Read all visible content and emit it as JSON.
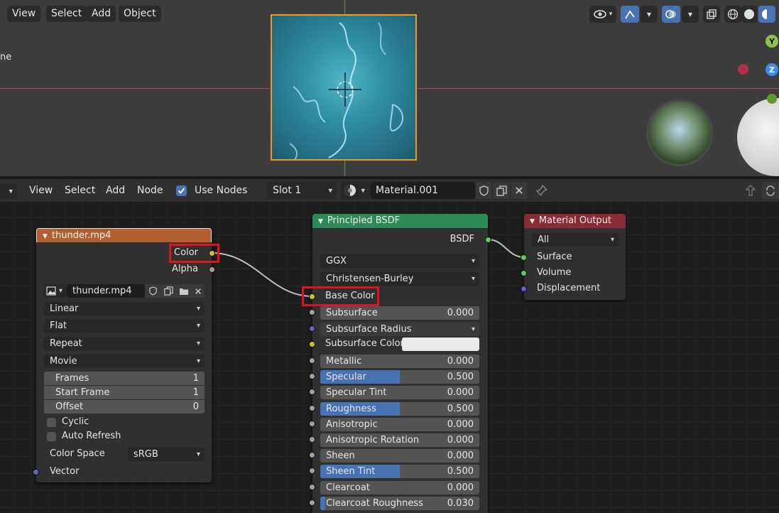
{
  "viewport": {
    "menu": [
      "View",
      "Select",
      "Add",
      "Object"
    ],
    "side_label": "ne",
    "gizmo": {
      "y": "Y",
      "z": "Z"
    }
  },
  "node_editor": {
    "menu": [
      "View",
      "Select",
      "Add",
      "Node"
    ],
    "use_nodes_label": "Use Nodes",
    "slot": "Slot 1",
    "material_name": "Material.001"
  },
  "image_node": {
    "title": "thunder.mp4",
    "outputs": [
      "Color",
      "Alpha"
    ],
    "image_name": "thunder.mp4",
    "interpolation": "Linear",
    "projection": "Flat",
    "extension": "Repeat",
    "source": "Movie",
    "fields": [
      {
        "label": "Frames",
        "value": "1"
      },
      {
        "label": "Start Frame",
        "value": "1"
      },
      {
        "label": "Offset",
        "value": "0"
      }
    ],
    "checkboxes": [
      "Cyclic",
      "Auto Refresh"
    ],
    "color_space_label": "Color Space",
    "color_space": "sRGB",
    "vector_label": "Vector"
  },
  "bsdf_node": {
    "title": "Principled BSDF",
    "output": "BSDF",
    "distribution": "GGX",
    "subsurface_method": "Christensen-Burley",
    "base_color_label": "Base Color",
    "subsurface_label": "Subsurface",
    "subsurface_value": "0.000",
    "subsurface_radius_label": "Subsurface Radius",
    "subsurface_color_label": "Subsurface Color",
    "params": [
      {
        "label": "Metallic",
        "value": "0.000",
        "fill": 0
      },
      {
        "label": "Specular",
        "value": "0.500",
        "fill": 0.5
      },
      {
        "label": "Specular Tint",
        "value": "0.000",
        "fill": 0
      },
      {
        "label": "Roughness",
        "value": "0.500",
        "fill": 0.5
      },
      {
        "label": "Anisotropic",
        "value": "0.000",
        "fill": 0
      },
      {
        "label": "Anisotropic Rotation",
        "value": "0.000",
        "fill": 0
      },
      {
        "label": "Sheen",
        "value": "0.000",
        "fill": 0
      },
      {
        "label": "Sheen Tint",
        "value": "0.500",
        "fill": 0.5
      },
      {
        "label": "Clearcoat",
        "value": "0.000",
        "fill": 0
      },
      {
        "label": "Clearcoat Roughness",
        "value": "0.030",
        "fill": 0.03
      }
    ]
  },
  "output_node": {
    "title": "Material Output",
    "target": "All",
    "inputs": [
      "Surface",
      "Volume",
      "Displacement"
    ]
  },
  "colors": {
    "image_header": "#b25f2f",
    "bsdf_header": "#2c8a55",
    "output_header": "#8a2a33",
    "accent_blue": "#4772b3",
    "highlight_red": "#e0141e"
  }
}
